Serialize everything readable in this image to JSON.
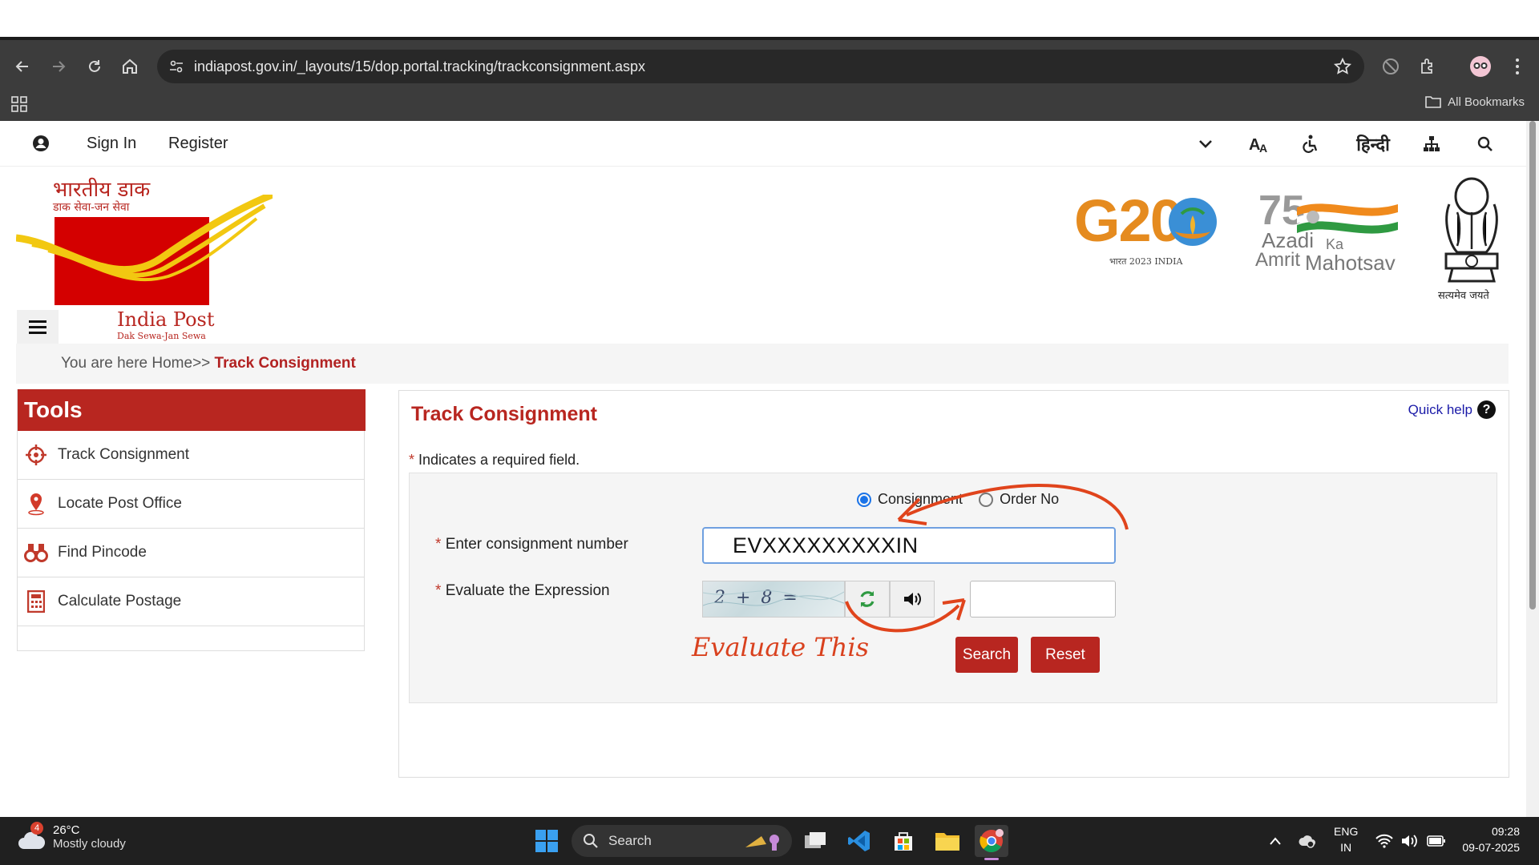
{
  "browser": {
    "url": "indiapost.gov.in/_layouts/15/dop.portal.tracking/trackconsignment.aspx",
    "all_bookmarks": "All Bookmarks"
  },
  "util": {
    "sign_in": "Sign In",
    "register": "Register",
    "hindi": "हिन्दी"
  },
  "header": {
    "logo_hindi_1": "भारतीय डाक",
    "logo_hindi_2": "डाक सेवा-जन सेवा",
    "logo_title": "India Post",
    "logo_tagline": "Dak Sewa-Jan Sewa",
    "g20_text": "G20",
    "g20_sub": "भारत 2023 INDIA",
    "azadi_75": "75",
    "azadi_1": "Azadi",
    "azadi_ka": "Ka",
    "azadi_2": "Amrit",
    "azadi_3": "Mahotsav",
    "emblem_motto": "सत्यमेव जयते"
  },
  "breadcrumb": {
    "prefix": "You are here Home>> ",
    "current": "Track Consignment"
  },
  "tools": {
    "title": "Tools",
    "items": [
      {
        "label": "Track Consignment",
        "icon": "crosshair-icon"
      },
      {
        "label": "Locate Post Office",
        "icon": "map-pin-icon"
      },
      {
        "label": "Find Pincode",
        "icon": "binoculars-icon"
      },
      {
        "label": "Calculate Postage",
        "icon": "calculator-icon"
      }
    ]
  },
  "panel": {
    "title": "Track Consignment",
    "quick_help": "Quick help",
    "required_note": "Indicates a required field.",
    "radio_consignment": "Consignment",
    "radio_other": "Order No",
    "label_consignment": "Enter consignment number",
    "consignment_value": "EVXXXXXXXXXIN",
    "label_expression": "Evaluate the Expression",
    "captcha_text": "2 + 8 =",
    "search": "Search",
    "reset": "Reset",
    "annotation": "Evaluate This"
  },
  "taskbar": {
    "temp": "26°C",
    "weather": "Mostly cloudy",
    "weather_badge": "4",
    "search": "Search",
    "lang_1": "ENG",
    "lang_2": "IN",
    "time": "09:28",
    "date": "09-07-2025"
  },
  "colors": {
    "brand_red": "#b82620",
    "annotation_orange": "#d9411e",
    "link_blue": "#1a1aa8"
  }
}
